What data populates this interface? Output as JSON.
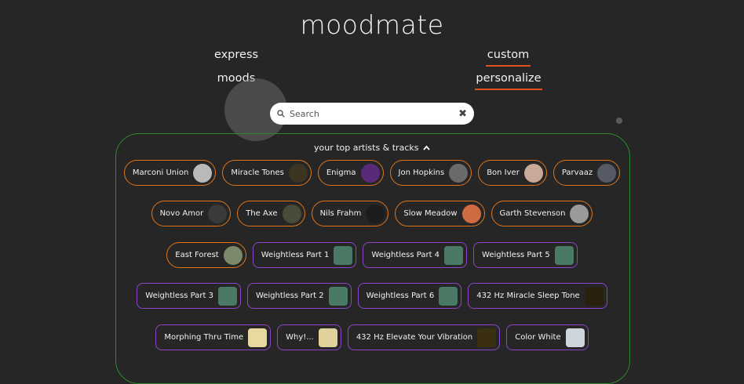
{
  "app": {
    "logo": "moodmate"
  },
  "nav": {
    "express": "express",
    "moods": "moods",
    "custom": "custom",
    "personalize": "personalize"
  },
  "search": {
    "placeholder": "Search",
    "clear": "✖"
  },
  "panel": {
    "title": "your top artists & tracks"
  },
  "rows": [
    [
      {
        "kind": "artist",
        "label": "Marconi Union",
        "thumb": "#b9b9b9"
      },
      {
        "kind": "artist",
        "label": "Miracle Tones",
        "thumb": "#3a3420"
      },
      {
        "kind": "artist",
        "label": "Enigma",
        "thumb": "#5a2a7a"
      },
      {
        "kind": "artist",
        "label": "Jon Hopkins",
        "thumb": "#6a6a6a"
      },
      {
        "kind": "artist",
        "label": "Bon Iver",
        "thumb": "#c9a99a"
      },
      {
        "kind": "artist",
        "label": "Parvaaz",
        "thumb": "#555a66"
      }
    ],
    [
      {
        "kind": "artist",
        "label": "Novo Amor",
        "thumb": "#3a3a3a"
      },
      {
        "kind": "artist",
        "label": "The Axe",
        "thumb": "#4a4a38"
      },
      {
        "kind": "artist",
        "label": "Nils Frahm",
        "thumb": "#1c1c1c"
      },
      {
        "kind": "artist",
        "label": "Slow Meadow",
        "thumb": "#d06a40"
      },
      {
        "kind": "artist",
        "label": "Garth Stevenson",
        "thumb": "#9a9a9a"
      }
    ],
    [
      {
        "kind": "artist",
        "label": "East Forest",
        "thumb": "#7a8a6a"
      },
      {
        "kind": "track",
        "label": "Weightless Part 1",
        "thumb": "#4a7a66"
      },
      {
        "kind": "track",
        "label": "Weightless Part 4",
        "thumb": "#4a7a66"
      },
      {
        "kind": "track",
        "label": "Weightless Part 5",
        "thumb": "#4a7a66"
      }
    ],
    [
      {
        "kind": "track",
        "label": "Weightless Part 3",
        "thumb": "#4a7a66"
      },
      {
        "kind": "track",
        "label": "Weightless Part 2",
        "thumb": "#4a7a66"
      },
      {
        "kind": "track",
        "label": "Weightless Part 6",
        "thumb": "#4a7a66"
      },
      {
        "kind": "track",
        "label": "432 Hz Miracle Sleep Tone",
        "thumb": "#2a2010"
      }
    ],
    [
      {
        "kind": "track",
        "label": "Morphing Thru Time",
        "thumb": "#e8d9a0"
      },
      {
        "kind": "track",
        "label": "Why!...",
        "thumb": "#e0d29a"
      },
      {
        "kind": "track",
        "label": "432 Hz Elevate Your Vibration",
        "thumb": "#3a3010"
      },
      {
        "kind": "track",
        "label": "Color White",
        "thumb": "#cdd5dd"
      }
    ]
  ],
  "colors": {
    "background": "#262626",
    "artist_border": "#e0761b",
    "track_border": "#8e44c8",
    "panel_border": "#2c8a2c",
    "active_underline": "#e2501d"
  }
}
